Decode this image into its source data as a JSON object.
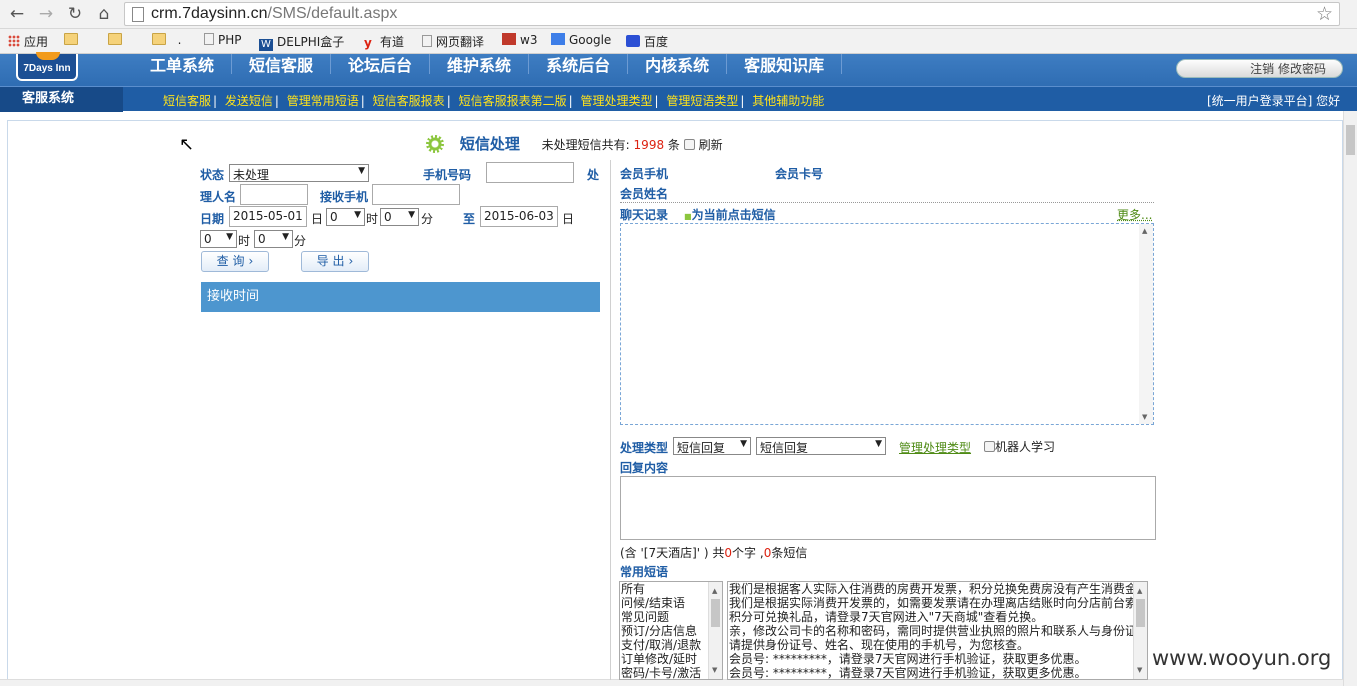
{
  "browser": {
    "url_host": "crm.7daysinn.cn",
    "url_path": "/SMS/default.aspx",
    "bookmarks": [
      "应用",
      ".",
      "PHP",
      "DELPHI盒子",
      "有道",
      "网页翻译",
      "w3",
      "Google",
      "百度"
    ]
  },
  "header": {
    "logo_text": "7Days Inn",
    "menu": [
      "工单系统",
      "短信客服",
      "论坛后台",
      "维护系统",
      "系统后台",
      "内核系统",
      "客服知识库"
    ],
    "account_links": "注销  修改密码"
  },
  "subnav": {
    "title": "客服系统",
    "links": [
      "短信客服",
      "发送短信",
      "管理常用短语",
      "短信客服报表",
      "短信客服报表第二版",
      "管理处理类型",
      "管理短语类型",
      "其他辅助功能"
    ],
    "right": "[统一用户登录平台] 您好"
  },
  "page": {
    "title": "短信处理",
    "pending_prefix": "未处理短信共有:",
    "pending_count": "1998",
    "pending_suffix": "条",
    "refresh_label": "刷新"
  },
  "filters": {
    "status_label": "状态",
    "status_value": "未处理",
    "phone_label": "手机号码",
    "handler_label_a": "处",
    "handler_label_b": "理人名",
    "receiver_label": "接收手机",
    "date_label": "日期",
    "date_from": "2015-05-01",
    "day_unit": "日",
    "hour_from": "0",
    "hour_unit": "时",
    "minute_from": "0",
    "minute_unit": "分",
    "to_label": "至",
    "date_to": "2015-06-03",
    "hour_to": "0",
    "minute_to": "0",
    "query_button": "查 询",
    "export_button": "导 出"
  },
  "results": {
    "column_receive_time": "接收时间"
  },
  "member": {
    "phone_label": "会员手机",
    "card_label": "会员卡号",
    "name_label": "会员姓名"
  },
  "chat": {
    "history_label": "聊天记录",
    "current_hint": "为当前点击短信",
    "more_link": "更多..."
  },
  "process": {
    "type_label": "处理类型",
    "type_value_1": "短信回复",
    "type_value_2": "短信回复",
    "manage_link": "管理处理类型",
    "robot_label": "机器人学习",
    "reply_label": "回复内容",
    "counter_text_a": "(含 '[7天酒店]' ) 共",
    "counter_chars": "0",
    "counter_text_b": "个字 ,",
    "counter_sms": "0",
    "counter_text_c": "条短信"
  },
  "phrases": {
    "label": "常用短语",
    "categories": [
      "所有",
      "问候/结束语",
      "常见问题",
      "预订/分店信息",
      "支付/取消/退款",
      "订单修改/延时",
      "密码/卡号/激活"
    ],
    "items": [
      "我们是根据客人实际入住消费的房费开发票，积分兑换免费房没有产生消费金",
      "我们是根据实际消费开发票的，如需要发票请在办理离店结账时向分店前台索",
      "积分可兑换礼品，请登录7天官网进入\"7天商城\"查看兑换。",
      "亲，修改公司卡的名称和密码，需同时提供营业执照的照片和联系人与身份证",
      "请提供身份证号、姓名、现在使用的手机号，为您核查。",
      "会员号: *********，请登录7天官网进行手机验证，获取更多优惠。",
      "会员号: *********，请登录7天官网进行手机验证，获取更多优惠。"
    ]
  },
  "watermark": "www.wooyun.org"
}
